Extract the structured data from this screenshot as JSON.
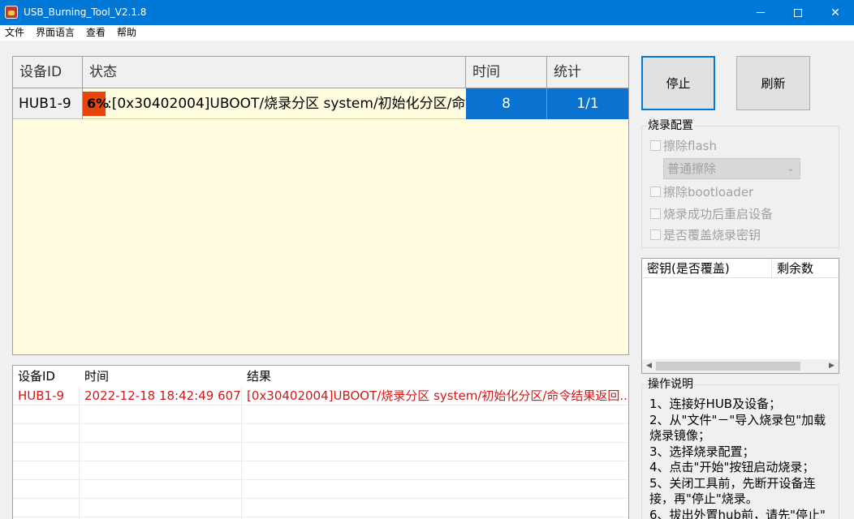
{
  "window": {
    "title": "USB_Burning_Tool_V2.1.8",
    "controls": {
      "minimize": "—",
      "maximize": "☐",
      "close": "✕"
    }
  },
  "menu": {
    "items": [
      "文件",
      "界面语言",
      "查看",
      "帮助"
    ]
  },
  "device_grid": {
    "columns": [
      "设备ID",
      "状态",
      "时间",
      "统计"
    ],
    "rows": [
      {
        "device_id": "HUB1-9",
        "progress_percent": 6,
        "progress_label": "6%",
        "status": ":[0x30402004]UBOOT/烧录分区 system/初始化分区/命",
        "time": "8",
        "count": "1/1"
      }
    ],
    "colors": {
      "progress": "#e8440c",
      "selected": "#0a72d0",
      "background": "#fffce0"
    }
  },
  "buttons": {
    "stop": "停止",
    "refresh": "刷新"
  },
  "burn_config": {
    "title": "烧录配置",
    "erase_flash": "擦除flash",
    "erase_mode": "普通擦除",
    "erase_bootloader": "擦除bootloader",
    "reboot_after": "烧录成功后重启设备",
    "overwrite_key": "是否覆盖烧录密钥"
  },
  "key_list": {
    "columns": [
      "密钥(是否覆盖)",
      "剩余数"
    ]
  },
  "log": {
    "columns": [
      "设备ID",
      "时间",
      "结果"
    ],
    "rows": [
      {
        "device_id": "HUB1-9",
        "time": "2022-12-18 18:42:49 607",
        "result": "[0x30402004]UBOOT/烧录分区 system/初始化分区/命令结果返回..."
      }
    ],
    "text_color": "#d01818"
  },
  "instructions": {
    "title": "操作说明",
    "lines": [
      "1、连接好HUB及设备；",
      "2、从\"文件\"－\"导入烧录包\"加载",
      "烧录镜像；",
      "3、选择烧录配置；",
      "4、点击\"开始\"按钮启动烧录；",
      "5、关闭工具前，先断开设备连",
      "接，再\"停止\"烧录。",
      "6、拔出外置hub前，请先\"停止\""
    ]
  }
}
